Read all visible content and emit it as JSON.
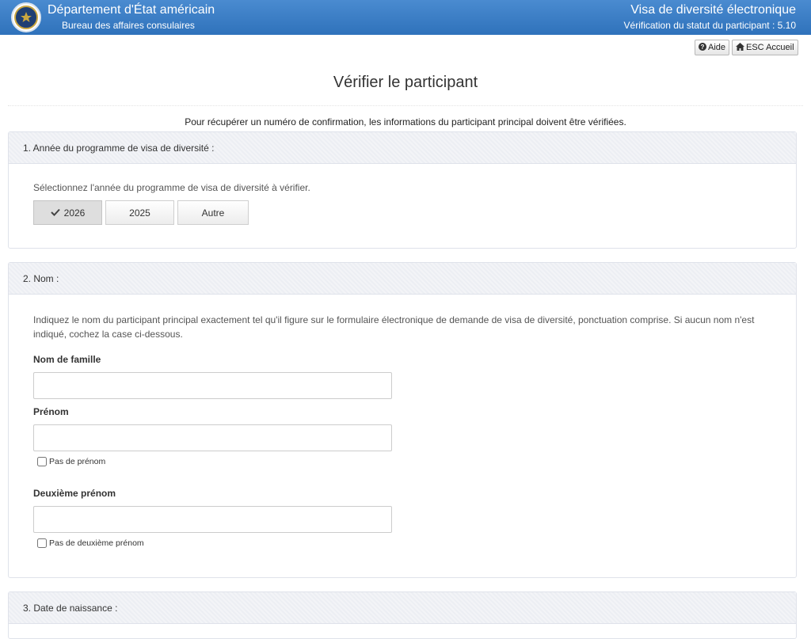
{
  "header": {
    "title": "Département d'État américain",
    "subtitle": "Bureau des affaires consulaires",
    "right_title": "Visa de diversité électronique",
    "right_subtitle": "Vérification du statut du participant : 5.10"
  },
  "toolbar": {
    "help_label": "Aide",
    "home_label": "ESC Accueil"
  },
  "page": {
    "title": "Vérifier le participant",
    "intro": "Pour récupérer un numéro de confirmation, les informations du participant principal doivent être vérifiées."
  },
  "section1": {
    "heading": "1. Année du programme de visa de diversité :",
    "help": "Sélectionnez l'année du programme de visa de diversité à vérifier.",
    "options": [
      "2026",
      "2025",
      "Autre"
    ],
    "selected": "2026"
  },
  "section2": {
    "heading": "2. Nom :",
    "help": "Indiquez le nom du participant principal exactement tel qu'il figure sur le formulaire électronique de demande de visa de diversité, ponctuation comprise. Si aucun nom n'est indiqué, cochez la case ci-dessous.",
    "last_name_label": "Nom de famille",
    "last_name_value": "",
    "first_name_label": "Prénom",
    "first_name_value": "",
    "no_first_name_label": "Pas de prénom",
    "middle_name_label": "Deuxième prénom",
    "middle_name_value": "",
    "no_middle_name_label": "Pas de deuxième prénom"
  },
  "section3": {
    "heading": "3. Date de naissance :"
  },
  "colors": {
    "header_blue": "#3a7dc4",
    "panel_border": "#dfe2ea",
    "panel_header": "#eceef3"
  }
}
